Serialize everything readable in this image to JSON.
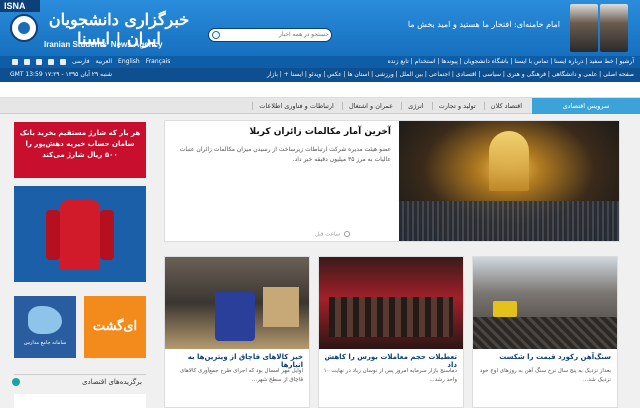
{
  "header": {
    "tag": "ISNA",
    "logo_fa": "خبرگزاری دانشجویان ایران | ایسنا",
    "logo_en": "Iranian Students' News Agency",
    "search_placeholder": "جستجو در همه اخبار",
    "motto": "امام خامنه‌ای: افتخار ما هستید و امید بخش ما",
    "brand_color": "#1a6cb8"
  },
  "util_bar": {
    "langs": [
      "فارسی",
      "العربية",
      "English",
      "Français"
    ],
    "right_text": "آرشیو | خط سفید | درباره ایسنا | تماس با ایسنا | باشگاه دانشجویان | پیوندها | استخدام | تابع زنده"
  },
  "time_bar": {
    "left": "GMT 13:59 شنبه ۲۹ آبان ۱۳۹۵ - ۱۷:۲۹",
    "right": "صفحه اصلی | علمی و دانشگاهی | فرهنگی و هنری | سیاسی | اقتصادی | اجتماعی | بین الملل | ورزشی | استان ها | عکس | ویدئو | ایسنا + | بازار"
  },
  "service": {
    "title": "سرویس اقتصادی",
    "subtabs": [
      "اقتصاد کلان",
      "تولید و تجارت",
      "انرژی",
      "عمران و اشتغال",
      "ارتباطات و فناوری اطلاعات"
    ]
  },
  "ads": {
    "banner": "هر بار که شارژ مستقیم بخرید بانک سامان حساب خیریه دهش‌پور را ۵۰۰ ریال شارژ می‌کند",
    "map": "سامانه جامع مدارس",
    "gasht": "ای‌گشت"
  },
  "selected_label": "برگزیده‌های اقتصادی",
  "featured": {
    "title": "آخرین آمار مکالمات زائران کربلا",
    "summary": "عضو هیئت مدیره شرکت ارتباطات زیرساخت از رسیدن میزان مکالمات زائران عتبات عالیات به مرز ۳۵ میلیون دقیقه خبر داد.",
    "time": "ساعت قبل"
  },
  "cards": [
    {
      "title": "خیز کالاهای قاچاق از ویترین‌ها به انبارها",
      "summary": "اوایل مهر امسال بود که اجرای طرح جمع‌آوری کالاهای قاچاق از سطح شهر..."
    },
    {
      "title": "تعطیلات حجم معاملات بورس را کاهش داد",
      "summary": "دماسنج بازار سرمایه امروز پس از نوسان زیاد در نهایت ۱۰ واحد رشد..."
    },
    {
      "title": "سنگ‌آهن رکورد قیمت را شکست",
      "summary": "بعداز نزدیک به پنج سال نرخ سنگ آهن به روزهای اوج خود نزدیک شد..."
    }
  ]
}
